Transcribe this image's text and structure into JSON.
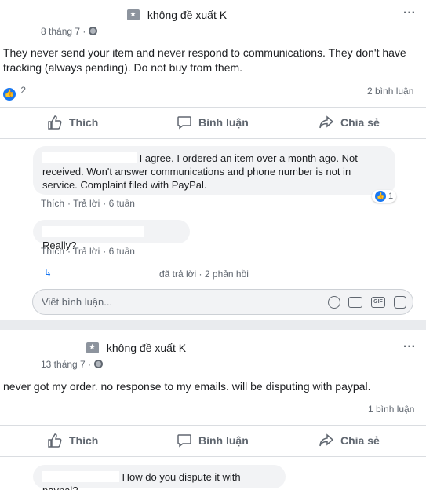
{
  "post1": {
    "author_label": "không đề xuất K",
    "date": "8 tháng 7 ·",
    "text": "They never send your item and never respond to communications. They don't have tracking (always pending). Do not buy from them.",
    "reaction_count": "2",
    "comment_count": "2 bình luận",
    "actions": {
      "like": "Thích",
      "comment": "Bình luận",
      "share": "Chia sẻ"
    },
    "comments": [
      {
        "text": "I agree. I ordered an item over a month ago. Not received. Won't answer communications and phone number is not in service. Complaint filed with PayPal.",
        "like": "Thích",
        "reply": "Trả lời",
        "age": "6 tuần",
        "reaction_count": "1"
      },
      {
        "text": "Really?",
        "like": "Thích",
        "reply": "Trả lời",
        "age": "6 tuần"
      }
    ],
    "replied": "đã trả lời · 2 phản hồi",
    "write_placeholder": "Viết bình luận..."
  },
  "post2": {
    "author_label": "không đề xuất K",
    "date": "13 tháng 7 ·",
    "text": "never got my order. no response to my emails. will be disputing with paypal.",
    "comment_count": "1 bình luận",
    "actions": {
      "like": "Thích",
      "comment": "Bình luận",
      "share": "Chia sẻ"
    },
    "comments": [
      {
        "text": "How do you dispute it with paypal?"
      }
    ]
  },
  "colors": {
    "accent": "#1877f2",
    "muted": "#606770",
    "bubble": "#f2f3f5"
  },
  "icons": {
    "recommend": "recommend-flag-icon",
    "globe": "globe-icon",
    "more": "more-dots-icon",
    "like": "thumbs-up-icon",
    "comment": "comment-bubble-icon",
    "share": "share-arrow-icon",
    "reply": "reply-arrow-icon",
    "emoji": "emoji-icon",
    "camera": "camera-icon",
    "gif": "gif-icon",
    "sticker": "sticker-icon"
  }
}
